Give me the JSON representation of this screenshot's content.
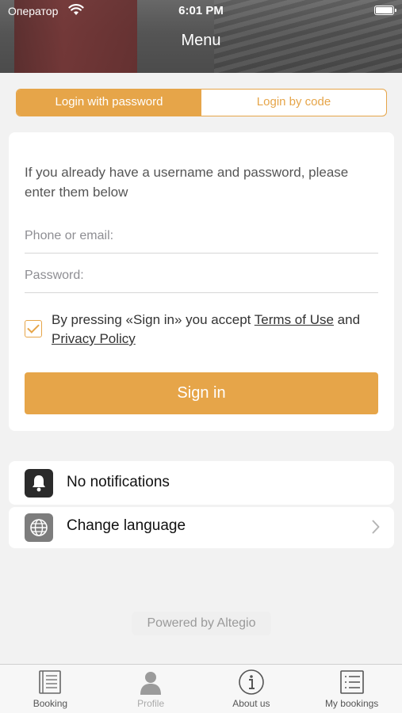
{
  "status_bar": {
    "carrier": "Оператор",
    "time": "6:01 PM"
  },
  "header": {
    "title": "Menu"
  },
  "login_tabs": {
    "password": "Login with password",
    "code": "Login by code"
  },
  "login_form": {
    "intro": "If you already have a username and password, please enter them below",
    "phone_placeholder": "Phone or email:",
    "password_placeholder": "Password:",
    "consent_prefix": "By pressing «Sign in» you accept ",
    "terms_link": "Terms of Use",
    "consent_and": " and ",
    "privacy_link": "Privacy Policy",
    "consent_checked": true,
    "sign_in": "Sign in"
  },
  "settings": {
    "notifications": "No notifications",
    "language": "Change language"
  },
  "footer": {
    "powered_by": "Powered by Altegio"
  },
  "tab_bar": {
    "booking": "Booking",
    "profile": "Profile",
    "about": "About us",
    "my_bookings": "My bookings"
  },
  "colors": {
    "accent": "#e6a549",
    "background": "#f2f2f2"
  }
}
